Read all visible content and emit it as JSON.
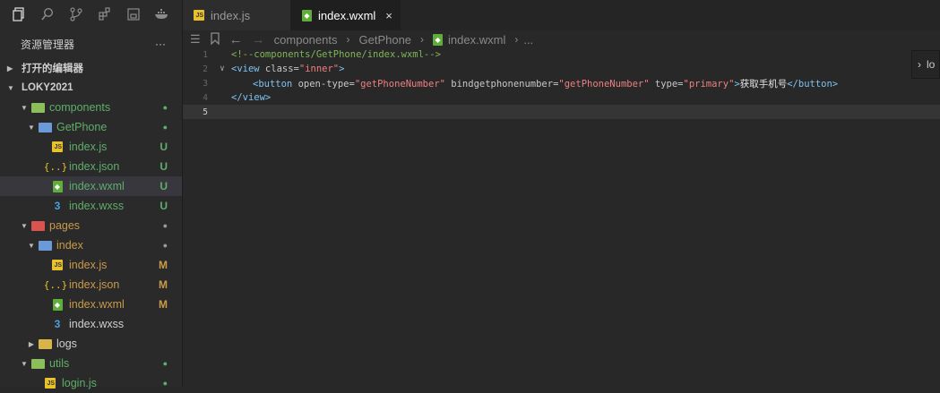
{
  "activity_bar": {
    "icons": [
      "files-icon",
      "search-icon",
      "source-control-icon",
      "extensions-icon",
      "debug-icon",
      "docker-icon"
    ]
  },
  "explorer": {
    "title": "资源管理器",
    "more": "···",
    "open_editors": "打开的编辑器",
    "project": "LOKY2021",
    "tree": [
      {
        "label": "components",
        "status": "●",
        "color": "#5fae6a"
      },
      {
        "label": "GetPhone",
        "status": "●",
        "color": "#5fae6a"
      },
      {
        "label": "index.js",
        "status": "U",
        "color": "#5fae6a"
      },
      {
        "label": "index.json",
        "status": "U",
        "color": "#5fae6a"
      },
      {
        "label": "index.wxml",
        "status": "U",
        "color": "#5fae6a"
      },
      {
        "label": "index.wxss",
        "status": "U",
        "color": "#5fae6a"
      },
      {
        "label": "pages",
        "status": "●",
        "color": "#c99a4a"
      },
      {
        "label": "index",
        "status": "●",
        "color": "#c99a4a"
      },
      {
        "label": "index.js",
        "status": "M",
        "color": "#c99a4a"
      },
      {
        "label": "index.json",
        "status": "M",
        "color": "#c99a4a"
      },
      {
        "label": "index.wxml",
        "status": "M",
        "color": "#c99a4a"
      },
      {
        "label": "index.wxss",
        "status": "",
        "color": "#cfcfcf"
      },
      {
        "label": "logs",
        "status": "",
        "color": "#cfcfcf"
      },
      {
        "label": "utils",
        "status": "●",
        "color": "#5fae6a"
      },
      {
        "label": "login.js",
        "status": "●",
        "color": "#5fae6a"
      }
    ]
  },
  "tabs": [
    {
      "label": "index.js",
      "active": false
    },
    {
      "label": "index.wxml",
      "active": true,
      "close": "×"
    }
  ],
  "breadcrumb": {
    "items": [
      "components",
      "GetPhone",
      "index.wxml",
      "..."
    ]
  },
  "code": {
    "lines": [
      {
        "num": "1",
        "comment": "<!--components/GetPhone/index.wxml-->"
      },
      {
        "num": "2",
        "open": "<view",
        "attr": " class=",
        "str": "\"inner\"",
        "close": ">"
      },
      {
        "num": "3",
        "t1": "<button",
        "a1": " open-type=",
        "s1": "\"getPhoneNumber\"",
        "a2": " bindgetphonenumber=",
        "s2": "\"getPhoneNumber\"",
        "a3": " type=",
        "s3": "\"primary\"",
        "t2": ">",
        "text": "获取手机号",
        "t3": "</button>"
      },
      {
        "num": "4",
        "close_tag": "</view>"
      },
      {
        "num": "5"
      }
    ]
  },
  "peek": {
    "label": "lo"
  },
  "colors": {
    "accent_green": "#5fae6a",
    "modified_orange": "#c99a4a",
    "tag_blue": "#7fc3f0",
    "string_red": "#f07f7f"
  }
}
